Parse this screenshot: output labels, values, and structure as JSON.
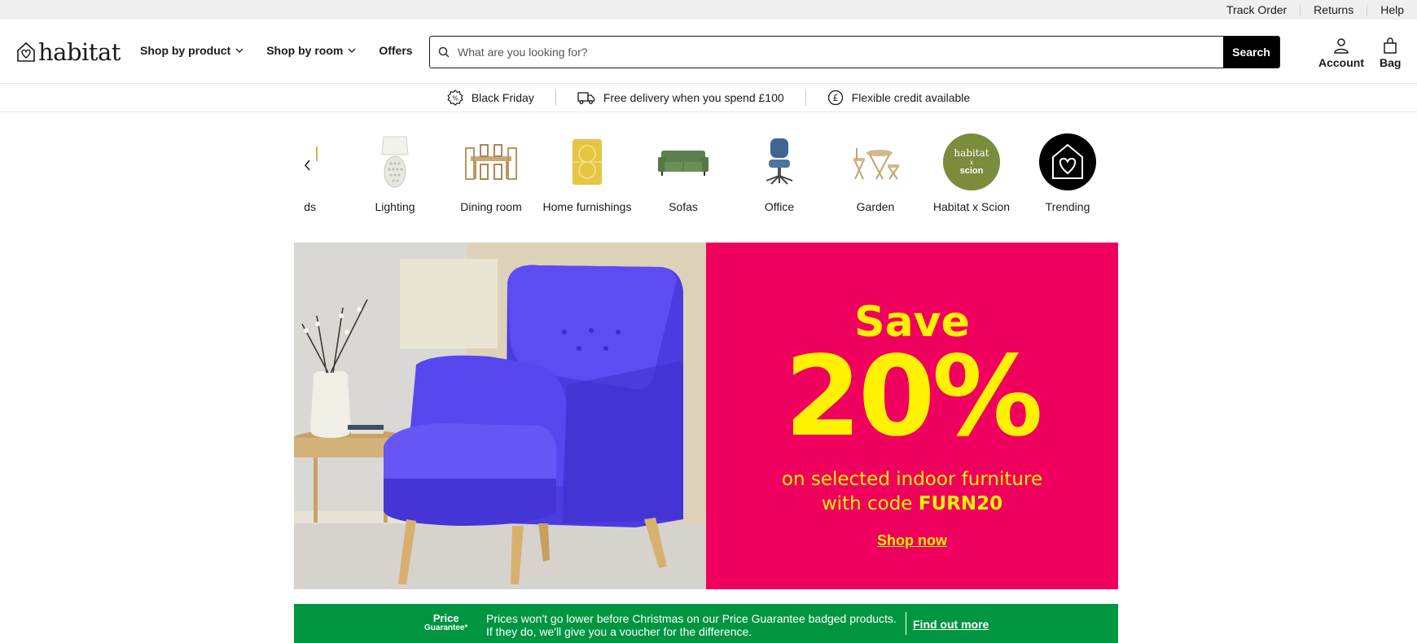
{
  "utility": {
    "links": [
      "Track Order",
      "Returns",
      "Help"
    ]
  },
  "header": {
    "logo_text": "habitat",
    "nav": [
      "Shop by product",
      "Shop by room",
      "Offers"
    ],
    "search": {
      "placeholder": "What are you looking for?",
      "button": "Search"
    },
    "account_label": "Account",
    "bag_label": "Bag"
  },
  "strip": {
    "items": [
      "Black Friday",
      "Free delivery when you spend £100",
      "Flexible credit available"
    ]
  },
  "categories": {
    "items": [
      {
        "label": "ds",
        "icon": "partial-category-image"
      },
      {
        "label": "Lighting",
        "icon": "table-lamp-image"
      },
      {
        "label": "Dining room",
        "icon": "dining-set-image"
      },
      {
        "label": "Home furnishings",
        "icon": "cushion-image"
      },
      {
        "label": "Sofas",
        "icon": "sofa-image"
      },
      {
        "label": "Office",
        "icon": "office-chair-image"
      },
      {
        "label": "Garden",
        "icon": "garden-furniture-image"
      },
      {
        "label": "Habitat x Scion",
        "icon": "habitat-scion-logo"
      },
      {
        "label": "Trending",
        "icon": "habitat-house-heart-logo"
      }
    ],
    "scion_badge": {
      "line1": "habitat",
      "line2": "x",
      "line3": "scion"
    }
  },
  "hero": {
    "save": "Save",
    "percent": "20%",
    "sub_line1": "on selected indoor furniture",
    "sub_line2_prefix": "with code ",
    "code": "FURN20",
    "cta": "Shop now",
    "colors": {
      "background": "#f0005e",
      "text": "#fff200",
      "chair": "#4f3de8"
    }
  },
  "price_guarantee": {
    "badge_line1": "Price",
    "badge_line2": "Guarantee*",
    "text_line1": "Prices won't go lower before Christmas on our Price Guarantee badged products.",
    "text_line2": "If they do, we'll give you a voucher for the difference.",
    "link": "Find out more",
    "color": "#009640"
  }
}
